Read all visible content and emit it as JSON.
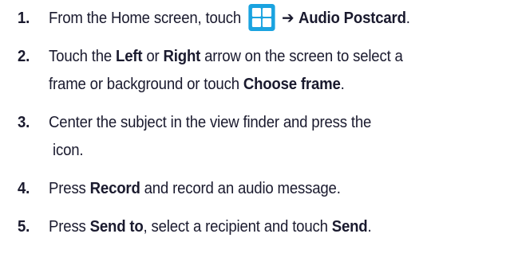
{
  "steps": [
    {
      "number": "1.",
      "text_before": "From the Home screen, touch",
      "icon": "apps-grid-icon",
      "arrow": "➔",
      "bold_1": "Audio Postcard",
      "text_after": "."
    },
    {
      "number": "2.",
      "line1_a": "Touch the ",
      "line1_bold_a": "Left",
      "line1_b": " or ",
      "line1_bold_b": "Right",
      "line1_c": " arrow on the screen to select a",
      "line2_a": "frame or background or touch ",
      "line2_bold": "Choose frame",
      "line2_b": "."
    },
    {
      "number": "3.",
      "line1": "Center the subject in the view finder and press the",
      "line2": " icon."
    },
    {
      "number": "4.",
      "text_before": "Press ",
      "bold_1": "Record",
      "text_after": " and record an audio message."
    },
    {
      "number": "5.",
      "text_before": "Press ",
      "bold_1": "Send to",
      "text_middle": ", select a recipient and touch ",
      "bold_2": "Send",
      "text_after": "."
    }
  ],
  "colors": {
    "text": "#1a1a2e",
    "icon_bg": "#1aa3e0",
    "icon_tiles": "#ffffff"
  }
}
